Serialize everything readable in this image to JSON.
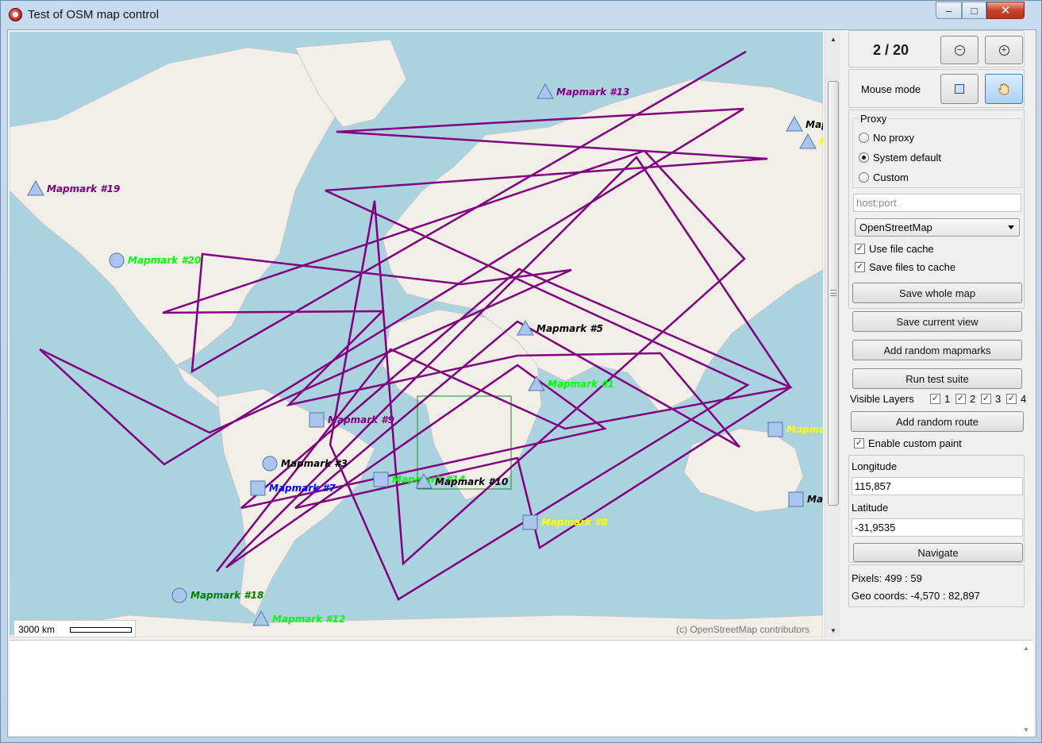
{
  "window": {
    "title": "Test of OSM map control",
    "min_glyph": "–",
    "max_glyph": "□",
    "close_glyph": "✕"
  },
  "map": {
    "scale_label": "3000 km",
    "attribution": "(c) OpenStreetMap contributors",
    "route_color": "#800080",
    "marks": [
      {
        "label": "Mapmark #13",
        "shape": "triangle",
        "color": "#800080"
      },
      {
        "label": "Mapmark #19",
        "shape": "triangle",
        "color": "#800080"
      },
      {
        "label": "Mapmark #20",
        "shape": "circle",
        "color": "#00ff00"
      },
      {
        "label": "Mapmark #5",
        "shape": "triangle",
        "color": "#000000"
      },
      {
        "label": "Mapmark #1",
        "shape": "triangle",
        "color": "#00ff00"
      },
      {
        "label": "Mapmark #9",
        "shape": "square",
        "color": "#800080"
      },
      {
        "label": "Mapmark #3",
        "shape": "circle",
        "color": "#000000"
      },
      {
        "label": "Mapmark #7",
        "shape": "square",
        "color": "#0000ff"
      },
      {
        "label": "Mapmark #14",
        "shape": "square",
        "color": "#00ff00"
      },
      {
        "label": "Mapmark #10",
        "shape": "triangle",
        "color": "#000000"
      },
      {
        "label": "Mapmark #8",
        "shape": "square",
        "color": "#ffff00"
      },
      {
        "label": "Mapmark #18",
        "shape": "circle",
        "color": "#008000"
      },
      {
        "label": "Mapmark #12",
        "shape": "triangle",
        "color": "#00ff00"
      },
      {
        "label": "Map",
        "shape": "triangle",
        "color": "#000000"
      },
      {
        "label": "M",
        "shape": "triangle",
        "color": "#ffff00"
      },
      {
        "label": "Mapma",
        "shape": "square",
        "color": "#ffff00"
      },
      {
        "label": "Map",
        "shape": "square",
        "color": "#000000"
      }
    ]
  },
  "panel": {
    "zoom_text": "2 / 20",
    "zoom_out_icon": "zoom-out-icon",
    "zoom_in_icon": "zoom-in-icon",
    "mouse_mode_label": "Mouse mode",
    "mouse_mode_select_icon": "rectangle-select-icon",
    "mouse_mode_pan_icon": "hand-pan-icon",
    "proxy": {
      "legend": "Proxy",
      "options": [
        "No proxy",
        "System default",
        "Custom"
      ],
      "selected": "System default"
    },
    "host_placeholder": "host:port",
    "tile_source": "OpenStreetMap",
    "use_file_cache": "Use file cache",
    "save_files_to_cache": "Save files to cache",
    "save_whole_map": "Save whole map",
    "save_current_view": "Save current view",
    "add_random_mapmarks": "Add random mapmarks",
    "run_test_suite": "Run test suite",
    "visible_layers_label": "Visible Layers",
    "layers": [
      "1",
      "2",
      "3",
      "4"
    ],
    "add_random_route": "Add random route",
    "enable_custom_paint": "Enable custom paint",
    "longitude_label": "Longitude",
    "longitude_value": "115,857",
    "latitude_label": "Latitude",
    "latitude_value": "-31,9535",
    "navigate": "Navigate",
    "pixels_readout": "Pixels: 499 : 59",
    "geo_readout": "Geo coords: -4,570 : 82,897"
  }
}
